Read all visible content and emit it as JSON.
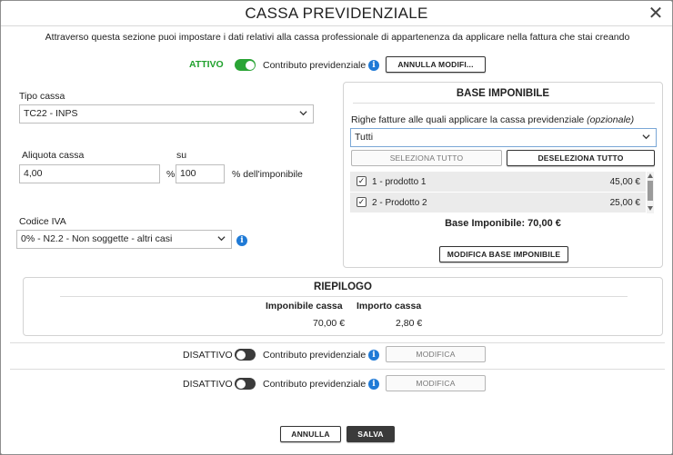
{
  "title": "CASSA PREVIDENZIALE",
  "intro": "Attraverso questa sezione puoi impostare i dati relativi alla cassa professionale di appartenenza da applicare nella fattura che stai creando",
  "contributo1": {
    "status": "ATTIVO",
    "label": "Contributo previdenziale 1",
    "info": "i",
    "button": "ANNULLA MODIFI..."
  },
  "tipo_cassa": {
    "label": "Tipo cassa",
    "value": "TC22 - INPS"
  },
  "aliquota": {
    "label": "Aliquota cassa",
    "value": "4,00",
    "percent": "%",
    "su_label": "su",
    "su_value": "100",
    "su_suffix": "% dell'imponibile"
  },
  "codice_iva": {
    "label": "Codice IVA",
    "value": "0% - N2.2 - Non soggette - altri casi",
    "info": "i"
  },
  "base_imponibile": {
    "title": "BASE IMPONIBILE",
    "righe_label": "Righe fatture alle quali applicare la cassa previdenziale",
    "righe_optional": "(opzionale)",
    "select_value": "Tutti",
    "select_all": "SELEZIONA TUTTO",
    "deselect_all": "DESELEZIONA TUTTO",
    "rows": [
      {
        "check": "✓",
        "name": "1 - prodotto 1",
        "amount": "45,00 €"
      },
      {
        "check": "✓",
        "name": "2 - Prodotto 2",
        "amount": "25,00 €"
      }
    ],
    "total": "Base Imponibile: 70,00 €",
    "modify_button": "MODIFICA BASE IMPONIBILE"
  },
  "riepilogo": {
    "title": "RIEPILOGO",
    "col1": "Imponibile cassa",
    "col2": "Importo cassa",
    "val1": "70,00 €",
    "val2": "2,80 €"
  },
  "contributo2": {
    "status": "DISATTIVO",
    "label": "Contributo previdenziale 2",
    "info": "i",
    "button": "MODIFICA"
  },
  "contributo3": {
    "status": "DISATTIVO",
    "label": "Contributo previdenziale 3",
    "info": "i",
    "button": "MODIFICA"
  },
  "footer": {
    "cancel": "ANNULLA",
    "save": "SALVA"
  },
  "colors": {
    "active": "#21a12e",
    "toggle_on": "#2aa435",
    "toggle_off": "#3b3b3b",
    "info": "#1f7ad6",
    "save_bg": "#3a3a3a"
  }
}
